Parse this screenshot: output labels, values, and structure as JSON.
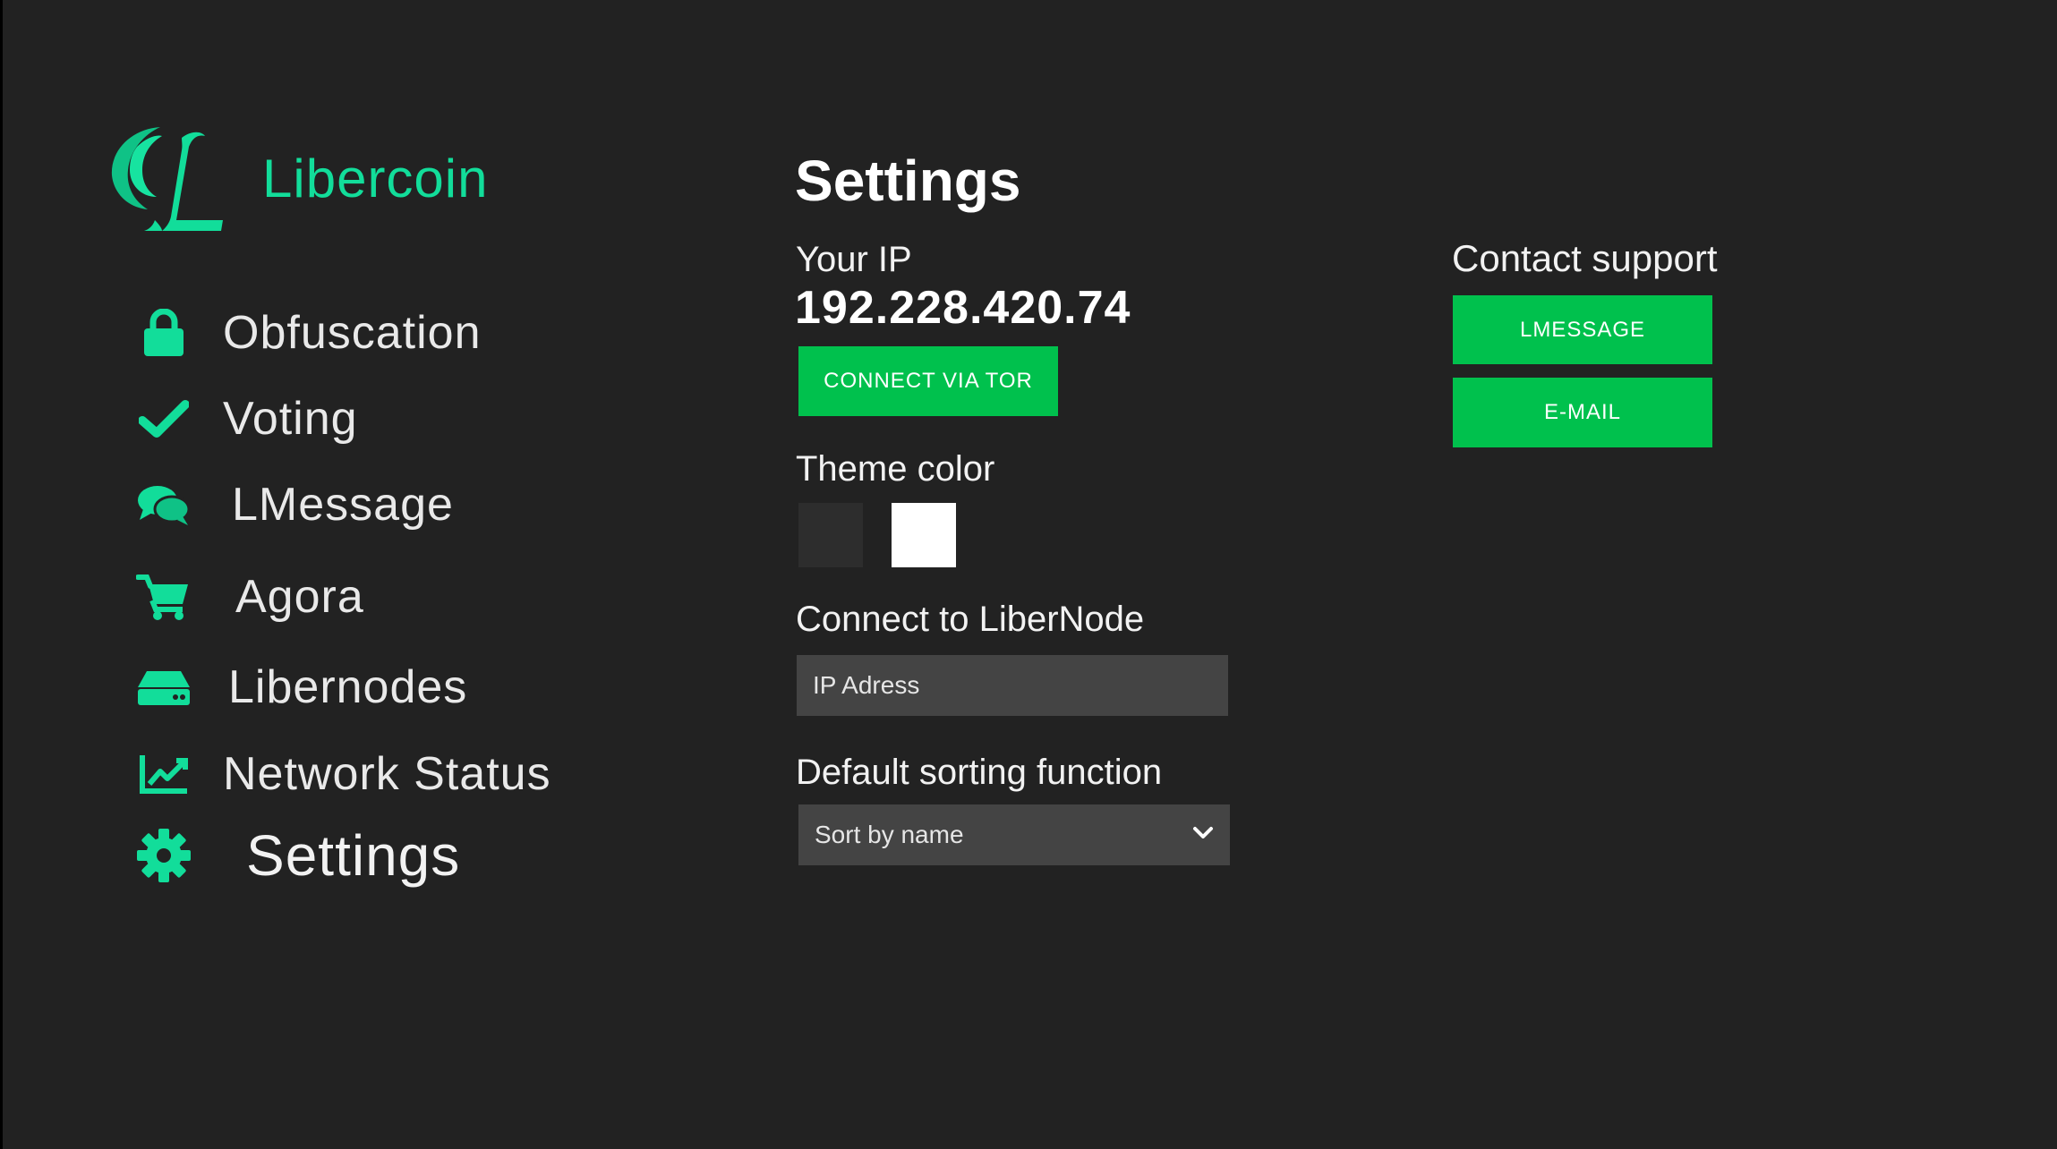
{
  "colors": {
    "accent": "#12dd9a",
    "button": "#00c14d",
    "background": "#222222",
    "input_background": "#444444",
    "theme_dark": "#2d2d2d",
    "theme_light": "#ffffff"
  },
  "brand": {
    "name": "Libercoin",
    "logo": "libercoin-logo"
  },
  "nav": {
    "items": [
      {
        "label": "Obfuscation",
        "icon": "lock-icon"
      },
      {
        "label": "Voting",
        "icon": "checkmark-icon"
      },
      {
        "label": "LMessage",
        "icon": "chat-bubbles-icon"
      },
      {
        "label": "Agora",
        "icon": "shopping-cart-icon"
      },
      {
        "label": "Libernodes",
        "icon": "server-drive-icon"
      },
      {
        "label": "Network Status",
        "icon": "line-chart-icon"
      },
      {
        "label": "Settings",
        "icon": "gear-icon"
      }
    ],
    "active": "Settings"
  },
  "settings": {
    "title": "Settings",
    "ip_label": "Your IP",
    "ip_value": "192.228.420.74",
    "tor_button": "CONNECT VIA TOR",
    "theme_label": "Theme color",
    "libernode_label": "Connect to LiberNode",
    "libernode_placeholder": "IP Adress",
    "sorting_label": "Default sorting function",
    "sorting_value": "Sort by name"
  },
  "contact": {
    "label": "Contact support",
    "lmessage_button": "LMESSAGE",
    "email_button": "E-MAIL"
  }
}
